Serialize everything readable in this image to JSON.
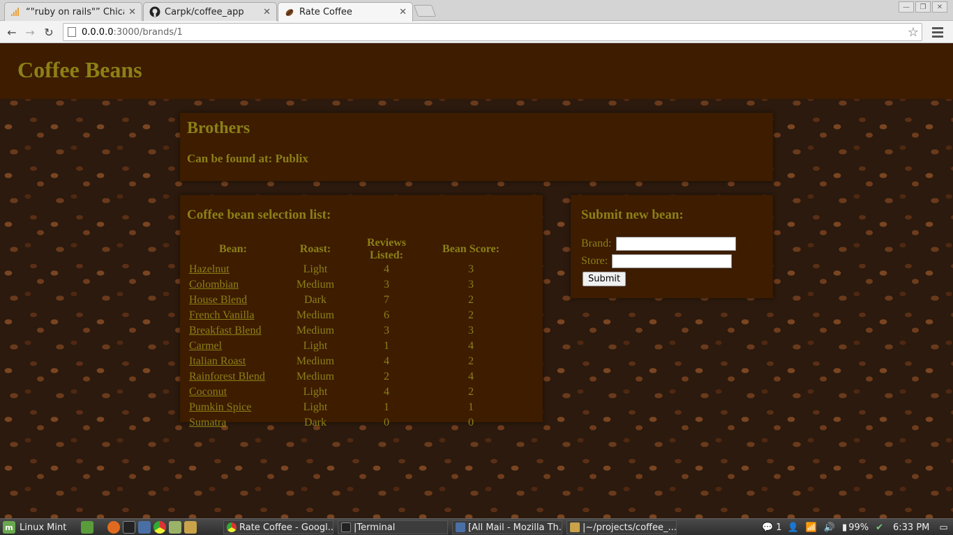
{
  "browser": {
    "tabs": [
      {
        "title": "“\"ruby on rails\"” Chicag",
        "icon": "signal-bars-icon"
      },
      {
        "title": "Carpk/coffee_app",
        "icon": "github-icon"
      },
      {
        "title": "Rate Coffee",
        "icon": "coffee-bean-icon",
        "active": true
      }
    ],
    "url_host": "0.0.0.0",
    "url_rest": ":3000/brands/1"
  },
  "page": {
    "site_title": "Coffee Beans",
    "brand_name": "Brothers",
    "found_at_label": "Can be found at:",
    "found_at_store": "Publix",
    "list_title": "Coffee bean selection list:",
    "columns": [
      "Bean:",
      "Roast:",
      "Reviews Listed:",
      "Bean Score:"
    ],
    "beans": [
      {
        "name": "Hazelnut",
        "roast": "Light",
        "reviews": "4",
        "score": "3"
      },
      {
        "name": "Colombian",
        "roast": "Medium",
        "reviews": "3",
        "score": "3"
      },
      {
        "name": "House Blend",
        "roast": "Dark",
        "reviews": "7",
        "score": "2"
      },
      {
        "name": "French Vanilla",
        "roast": "Medium",
        "reviews": "6",
        "score": "2"
      },
      {
        "name": "Breakfast Blend",
        "roast": "Medium",
        "reviews": "3",
        "score": "3"
      },
      {
        "name": "Carmel",
        "roast": "Light",
        "reviews": "1",
        "score": "4"
      },
      {
        "name": "Italian Roast",
        "roast": "Medium",
        "reviews": "4",
        "score": "2"
      },
      {
        "name": "Rainforest Blend",
        "roast": "Medium",
        "reviews": "2",
        "score": "4"
      },
      {
        "name": "Coconut",
        "roast": "Light",
        "reviews": "4",
        "score": "2"
      },
      {
        "name": "Pumkin Spice",
        "roast": "Light",
        "reviews": "1",
        "score": "1"
      },
      {
        "name": "Sumatra",
        "roast": "Dark",
        "reviews": "0",
        "score": "0"
      }
    ],
    "form": {
      "title": "Submit new bean:",
      "brand_label": "Brand:",
      "brand_value": "",
      "store_label": "Store:",
      "store_value": "",
      "submit_label": "Submit"
    },
    "colors": {
      "header_bg": "#3d1c00",
      "text": "#8c8017"
    }
  },
  "taskbar": {
    "menu_label": "Linux Mint",
    "tasks": [
      {
        "label": "Rate Coffee - Googl...",
        "icon": "chrome-icon"
      },
      {
        "label": "|Terminal",
        "icon": "terminal-icon"
      },
      {
        "label": "[All Mail - Mozilla Th...",
        "icon": "thunderbird-icon"
      },
      {
        "label": "|~/projects/coffee_...",
        "icon": "editor-icon"
      }
    ],
    "notifications": "1",
    "battery": "99%",
    "clock": "6:33 PM"
  }
}
